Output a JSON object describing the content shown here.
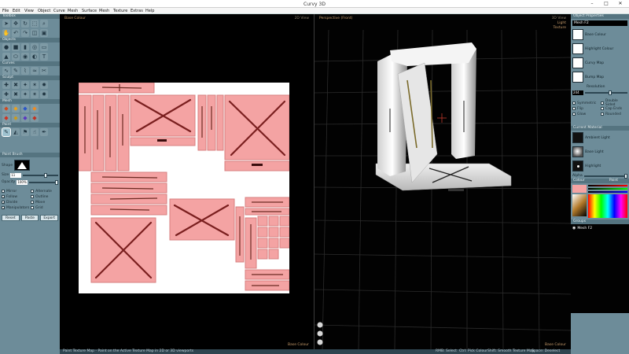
{
  "app": {
    "title": "Curvy 3D"
  },
  "menu": [
    "File",
    "Edit",
    "View",
    "Object",
    "Curve",
    "Mesh",
    "Surface",
    "Mesh",
    "Texture",
    "Extras",
    "Help"
  ],
  "toolbox": {
    "header": "Toolbox",
    "sections": [
      "Objects",
      "Curves",
      "Sculpt",
      "Mesh",
      "Paint"
    ]
  },
  "paint_brush": {
    "header": "Paint Brush",
    "shape_label": "Shape",
    "size_label": "Size",
    "size_value": "11",
    "opacity_label": "Opacity",
    "opacity_value": "100%",
    "checkboxes": [
      {
        "label": "Mirror",
        "checked": false
      },
      {
        "label": "Alternate",
        "checked": false
      },
      {
        "label": "Follow",
        "checked": true
      },
      {
        "label": "Outline",
        "checked": false
      },
      {
        "label": "Divide",
        "checked": true
      },
      {
        "label": "Move",
        "checked": false
      },
      {
        "label": "Manipulators",
        "checked": true
      },
      {
        "label": "Grid",
        "checked": false
      }
    ],
    "buttons": [
      "Reset",
      "Paste",
      "Export"
    ]
  },
  "texture_view": {
    "top_left": "Base Colour",
    "top_right": "2D View",
    "bottom_right": "Base Colour"
  },
  "view3d": {
    "top_left": "Perspective (Front)",
    "top_right": "3D View",
    "right_sub1": "Light",
    "right_sub2": "Texture",
    "bottom_right": "Base Colour"
  },
  "object_properties": {
    "header": "Object Properties",
    "name": "Mesh F2",
    "rows": [
      "Base Colour",
      "Highlight Colour",
      "Curvy Map",
      "Bump Map"
    ],
    "resolution_label": "Resolution",
    "resolution_value": "244",
    "flags": [
      "Symmetric",
      "Double Sided",
      "Flip",
      "Cap Ends",
      "Glow",
      "Rounded"
    ]
  },
  "current_material": {
    "header": "Current Material",
    "rows": [
      "Ambient Light",
      "Base Light",
      "Highlight"
    ],
    "alpha_label": "Alpha"
  },
  "colour": {
    "header": "Colour",
    "right_label": "Paint"
  },
  "groups": {
    "header": "Groups",
    "items": [
      "Mesh F2"
    ]
  },
  "status": {
    "left": "Paint Texture Map - Paint on the Active Texture Map in 2D or 3D viewports",
    "r1": "RMB: Select",
    "r2": "Ctrl: Pick Colour",
    "r3": "Shift: Smooth Texture Map",
    "r4": "Space: Deselect"
  },
  "accent": "#6d8c99",
  "texture_color": "#f4a3a3"
}
